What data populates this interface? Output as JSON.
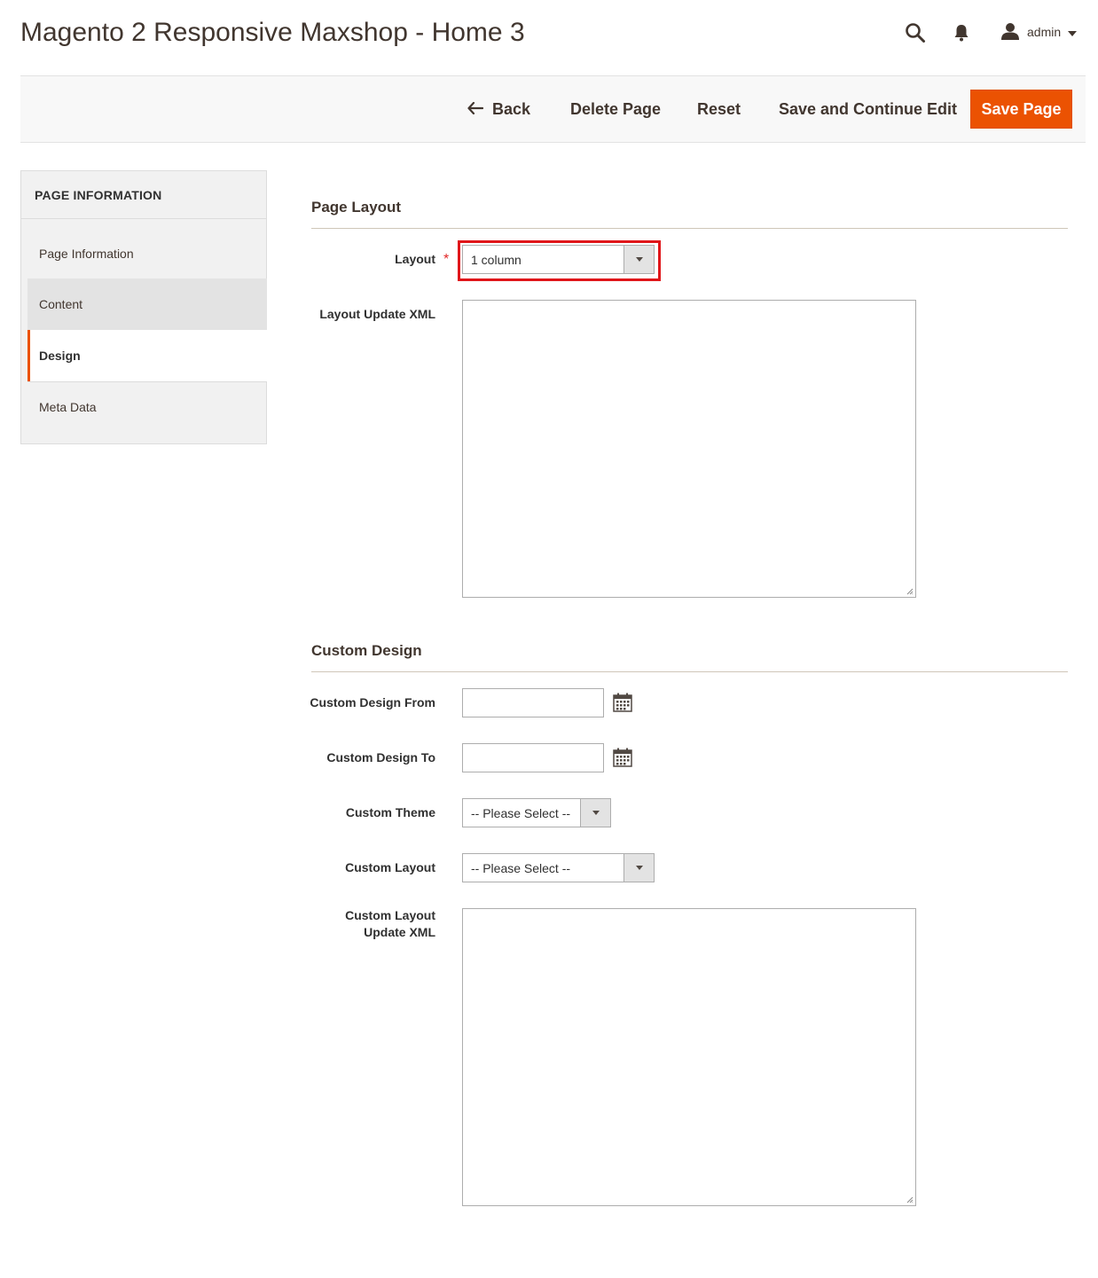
{
  "header": {
    "title": "Magento 2 Responsive Maxshop - Home 3",
    "user": "admin",
    "icons": {
      "search": "search-icon",
      "notifications": "bell-icon",
      "user": "user-icon",
      "dropdown": "caret-down-icon"
    }
  },
  "actions": {
    "back": "Back",
    "delete": "Delete Page",
    "reset": "Reset",
    "save_continue": "Save and Continue Edit",
    "save": "Save Page"
  },
  "sidebar": {
    "title": "PAGE INFORMATION",
    "items": [
      {
        "label": "Page Information"
      },
      {
        "label": "Content"
      },
      {
        "label": "Design",
        "active": true
      },
      {
        "label": "Meta Data"
      }
    ]
  },
  "page_layout": {
    "title": "Page Layout",
    "layout_label": "Layout",
    "required_mark": "*",
    "layout_value": "1 column",
    "layout_update_xml_label": "Layout Update XML",
    "layout_update_xml_value": ""
  },
  "custom_design": {
    "title": "Custom Design",
    "from_label": "Custom Design From",
    "from_value": "",
    "to_label": "Custom Design To",
    "to_value": "",
    "theme_label": "Custom Theme",
    "theme_value": "-- Please Select --",
    "layout_label": "Custom Layout",
    "layout_value": "-- Please Select --",
    "layout_update_xml_label_1": "Custom Layout",
    "layout_update_xml_label_2": "Update XML",
    "layout_update_xml_value": ""
  },
  "colors": {
    "accent": "#eb5202",
    "highlight": "#e0161a"
  }
}
